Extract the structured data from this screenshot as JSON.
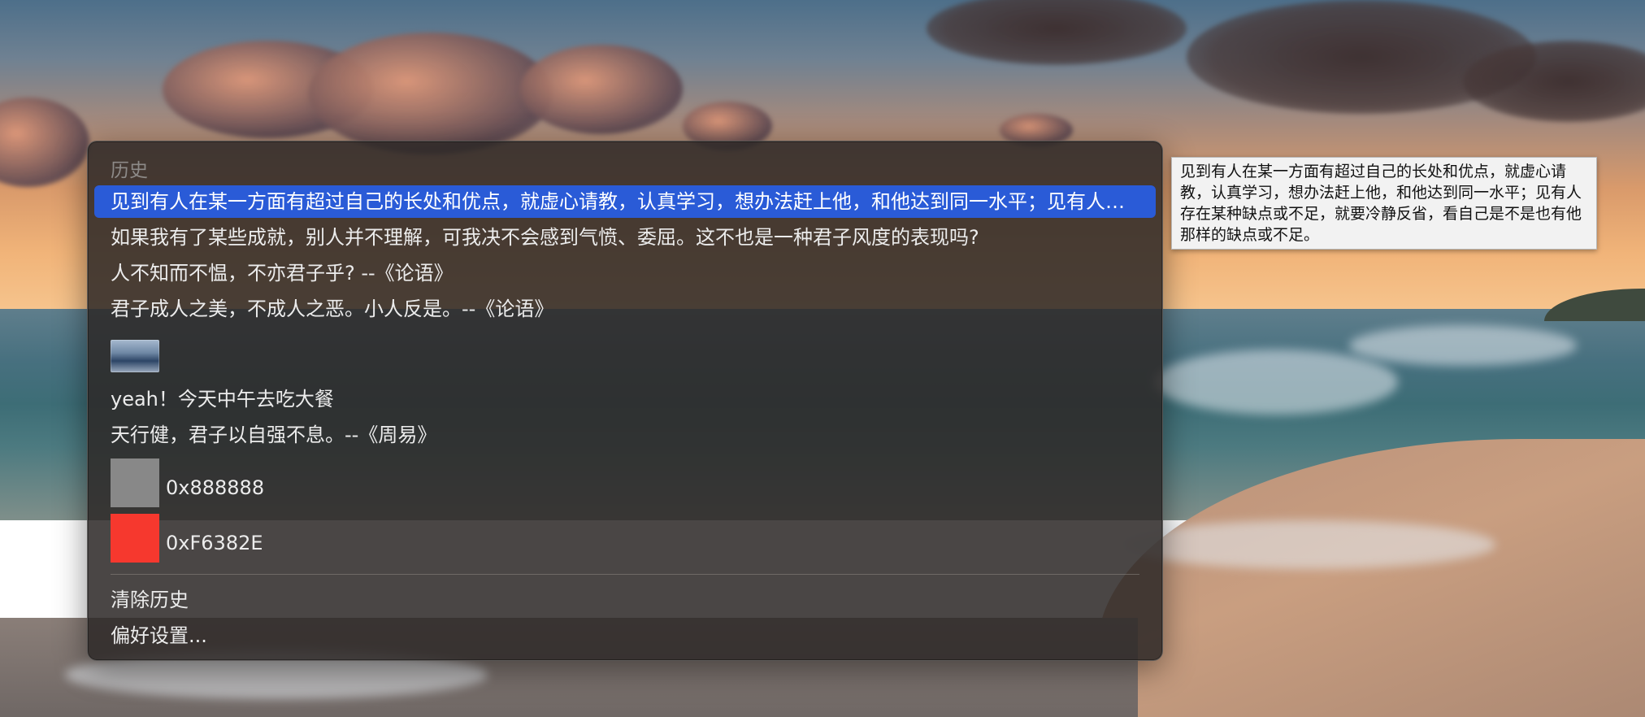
{
  "menu": {
    "header": "历史",
    "items": [
      {
        "type": "text",
        "label": "见到有人在某一方面有超过自己的长处和优点，就虚心请教，认真学习，想办法赶上他，和他达到同一水平；见有人存在某种缺点或不足，就要冷静反省，看自己是不是也有他那样的缺点或不足。",
        "selected": true
      },
      {
        "type": "text",
        "label": "如果我有了某些成就，别人并不理解，可我决不会感到气愤、委屈。这不也是一种君子风度的表现吗?"
      },
      {
        "type": "text",
        "label": "人不知而不愠，不亦君子乎? --《论语》"
      },
      {
        "type": "text",
        "label": "君子成人之美，不成人之恶。小人反是。--《论语》"
      },
      {
        "type": "image"
      },
      {
        "type": "text",
        "label": "yeah！今天中午去吃大餐"
      },
      {
        "type": "text",
        "label": "天行健，君子以自强不息。--《周易》"
      },
      {
        "type": "color",
        "label": "0x888888",
        "color": "#888888"
      },
      {
        "type": "color",
        "label": "0xF6382E",
        "color": "#F6382E"
      }
    ],
    "actions": {
      "clear_history": "清除历史",
      "preferences": "偏好设置..."
    }
  },
  "tooltip": {
    "text": "见到有人在某一方面有超过自己的长处和优点，就虚心请教，认真学习，想办法赶上他，和他达到同一水平；见有人存在某种缺点或不足，就要冷静反省，看自己是不是也有他那样的缺点或不足。"
  },
  "colors": {
    "selection": "#2a5bd7",
    "menu_background": "#2c2827",
    "tooltip_background": "#f2f2f2"
  }
}
